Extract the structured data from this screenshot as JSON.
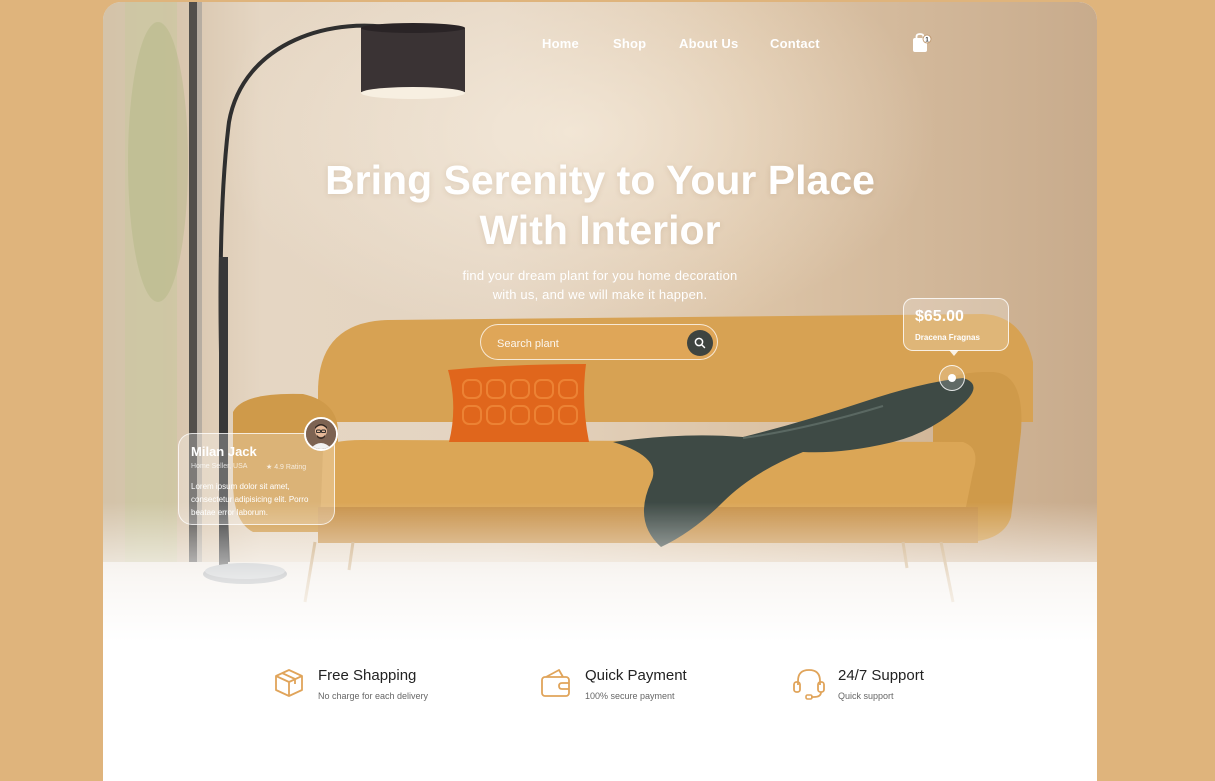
{
  "nav": {
    "links": [
      "Home",
      "Shop",
      "About Us",
      "Contact"
    ],
    "cart_count": "1"
  },
  "hero": {
    "headline_line1": "Bring Serenity to Your Place",
    "headline_line2": "With Interior",
    "subtitle_line1": "find your dream plant for you home decoration",
    "subtitle_line2": "with us, and we will make it happen."
  },
  "search": {
    "placeholder": "Search plant"
  },
  "product_tag": {
    "price": "$65.00",
    "name": "Dracena Fragnas"
  },
  "review": {
    "name": "Milan Jack",
    "role": "Home Seller, USA",
    "rating": "★ 4.9 Rating",
    "text": "Lorem ipsum dolor sit amet, consectetur adipisicing elit. Porro beatae error laborum."
  },
  "features": [
    {
      "title": "Free Shapping",
      "subtitle": "No charge for each delivery",
      "icon": "box-icon"
    },
    {
      "title": "Quick Payment",
      "subtitle": "100% secure payment",
      "icon": "wallet-icon"
    },
    {
      "title": "24/7 Support",
      "subtitle": "Quick support",
      "icon": "headset-icon"
    }
  ],
  "colors": {
    "background": "#dfb47c",
    "accent": "#e0a45a",
    "sofa": "#d9a455",
    "pillow": "#e0661c",
    "blanket": "#3e4a45",
    "search_button": "#3e4440"
  }
}
